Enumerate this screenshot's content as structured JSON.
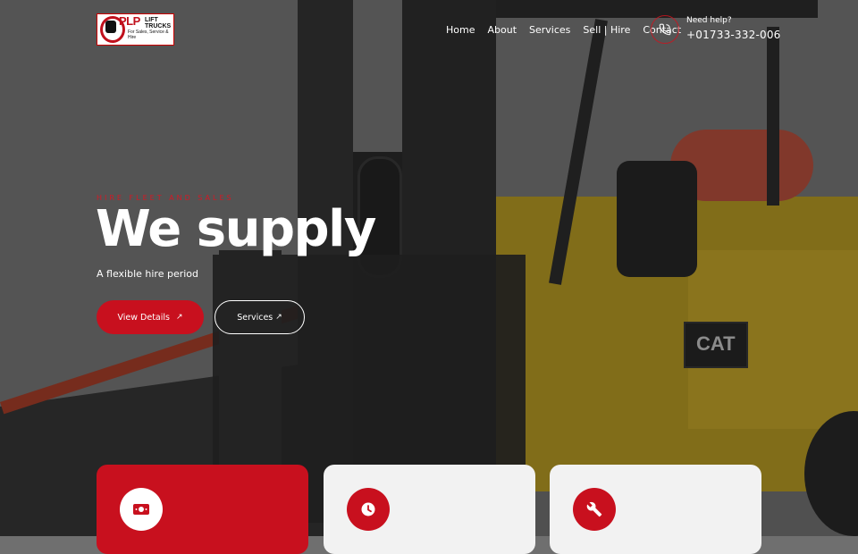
{
  "header": {
    "logo": {
      "brand": "PLP",
      "name": "LIFT TRUCKS",
      "tagline": "For Sales, Service & Hire"
    },
    "nav": [
      "Home",
      "About",
      "Services",
      "Sell | Hire",
      "Contact"
    ],
    "help_label": "Need help?",
    "help_phone": "+01733-332-006"
  },
  "hero": {
    "eyebrow": "HIRE FLEET AND SALES",
    "headline": "We supply",
    "subline": "A flexible hire period",
    "primary_button": "View Details",
    "secondary_button": "Services"
  },
  "cards": [
    {
      "icon": "money-icon"
    },
    {
      "icon": "clock-icon"
    },
    {
      "icon": "wrench-icon"
    }
  ],
  "colors": {
    "accent": "#c8101e",
    "card_light": "#f2f2f2"
  }
}
